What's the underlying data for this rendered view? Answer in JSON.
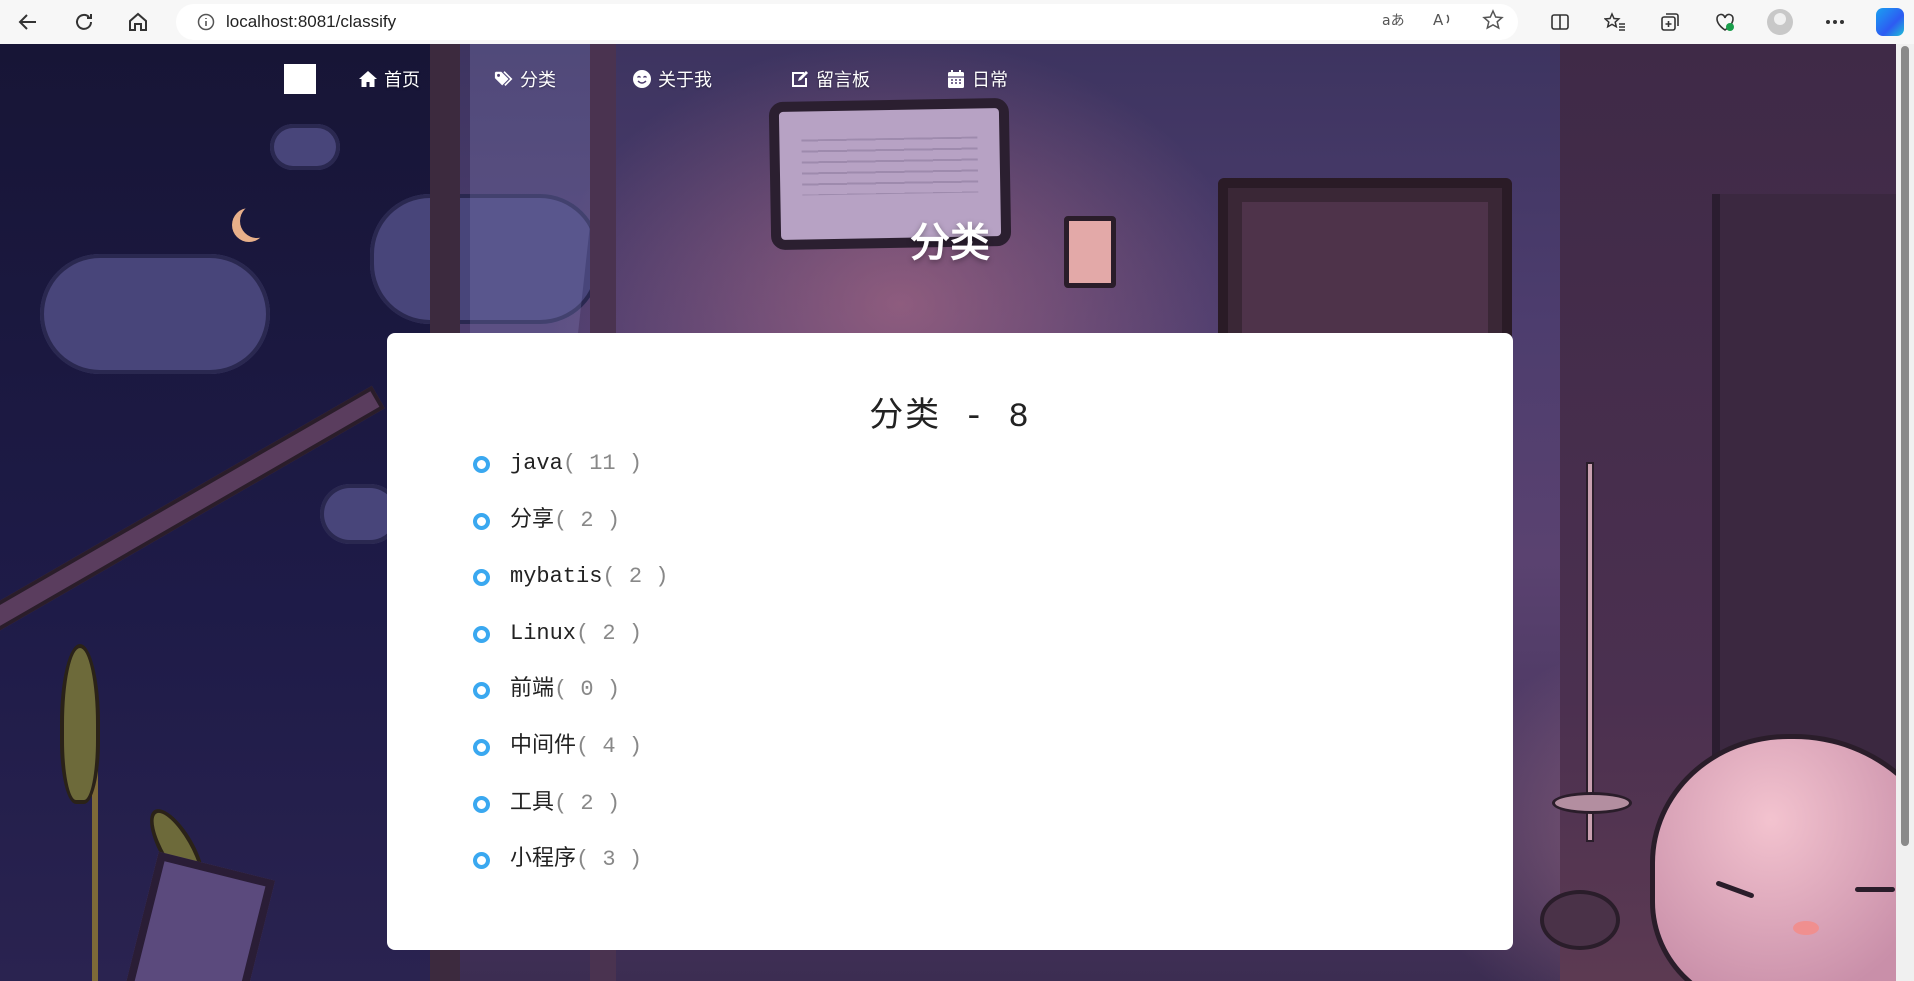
{
  "browser": {
    "url": "localhost:8081/classify",
    "icons": [
      "back-icon",
      "refresh-icon",
      "home-icon",
      "info-icon",
      "translate-icon",
      "read-aloud-icon",
      "favorite-star-icon",
      "split-screen-icon",
      "favorites-icon",
      "collections-icon",
      "browser-essentials-icon",
      "profile-icon",
      "more-icon",
      "copilot-icon"
    ]
  },
  "nav": {
    "items": [
      {
        "label": "首页",
        "icon": "home-icon"
      },
      {
        "label": "分类",
        "icon": "tags-icon"
      },
      {
        "label": "关于我",
        "icon": "smile-icon"
      },
      {
        "label": "留言板",
        "icon": "edit-icon"
      },
      {
        "label": "日常",
        "icon": "calendar-icon"
      }
    ]
  },
  "hero": {
    "title": "分类"
  },
  "card": {
    "title": "分类 - 8",
    "categories": [
      {
        "name": "java",
        "count": "( 11 )"
      },
      {
        "name": "分享",
        "count": "( 2 )"
      },
      {
        "name": "mybatis",
        "count": "( 2 )"
      },
      {
        "name": "Linux",
        "count": "( 2 )"
      },
      {
        "name": "前端",
        "count": "( 0 )"
      },
      {
        "name": "中间件",
        "count": "( 4 )"
      },
      {
        "name": "工具",
        "count": "( 2 )"
      },
      {
        "name": "小程序",
        "count": "( 3 )"
      }
    ]
  },
  "colors": {
    "accent": "#3aa8f0",
    "card": "#ffffff"
  }
}
